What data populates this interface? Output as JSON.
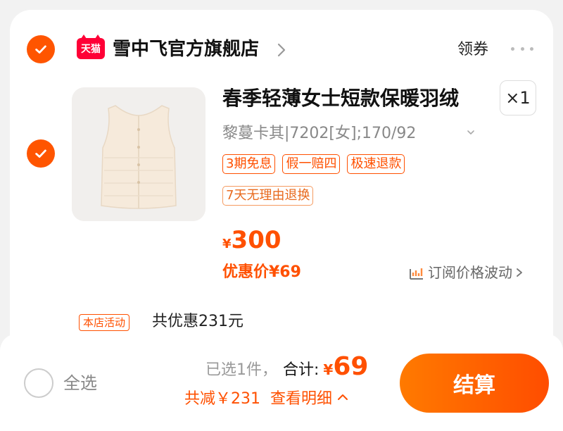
{
  "store": {
    "badge": "天猫",
    "name": "雪中飞官方旗舰店",
    "coupon_label": "领券"
  },
  "item": {
    "title": "春季轻薄女士短款保暖羽绒",
    "quantity": "×1",
    "sku": "黎蔓卡其|7202[女];170/92",
    "tags": [
      "3期免息",
      "假一赔四",
      "极速退款",
      "7天无理由退换"
    ],
    "price_currency": "¥",
    "price": "300",
    "discount_price": "优惠价¥69",
    "subscribe_label": "订阅价格波动"
  },
  "activity": {
    "badge": "本店活动",
    "text": "共优惠231元"
  },
  "footer": {
    "select_all": "全选",
    "selected_count": "已选1件，",
    "total_label": "合计:",
    "total_currency": "¥",
    "total": "69",
    "savings": "共减￥231",
    "detail_label": "查看明细",
    "checkout_label": "结算"
  },
  "colors": {
    "accent": "#ff5000",
    "tmall_red": "#ff0036",
    "background": "#f2f2f2"
  },
  "icons": [
    "check-icon",
    "tmall-logo",
    "chevron-right-icon",
    "more-icon",
    "chevron-down-icon",
    "price-chart-icon",
    "chevron-up-icon"
  ]
}
